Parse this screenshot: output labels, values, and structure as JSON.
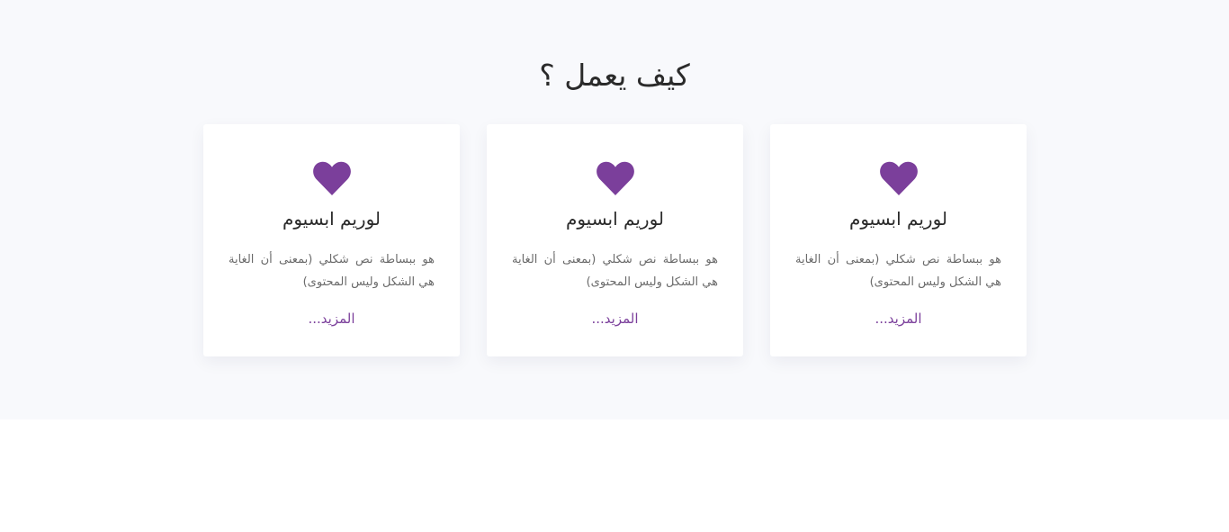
{
  "section": {
    "title": "كيف يعمل ؟"
  },
  "accent_color": "#7b3f9b",
  "cards": [
    {
      "icon": "heart-icon",
      "title": "لوريم ابسيوم",
      "text": "هو ببساطة نص شكلي (بمعنى أن الغاية هي الشكل وليس المحتوى)",
      "link": "المزيد..."
    },
    {
      "icon": "heart-icon",
      "title": "لوريم ابسيوم",
      "text": "هو ببساطة نص شكلي (بمعنى أن الغاية هي الشكل وليس المحتوى)",
      "link": "المزيد..."
    },
    {
      "icon": "heart-icon",
      "title": "لوريم ابسيوم",
      "text": "هو ببساطة نص شكلي (بمعنى أن الغاية هي الشكل وليس المحتوى)",
      "link": "المزيد..."
    }
  ]
}
